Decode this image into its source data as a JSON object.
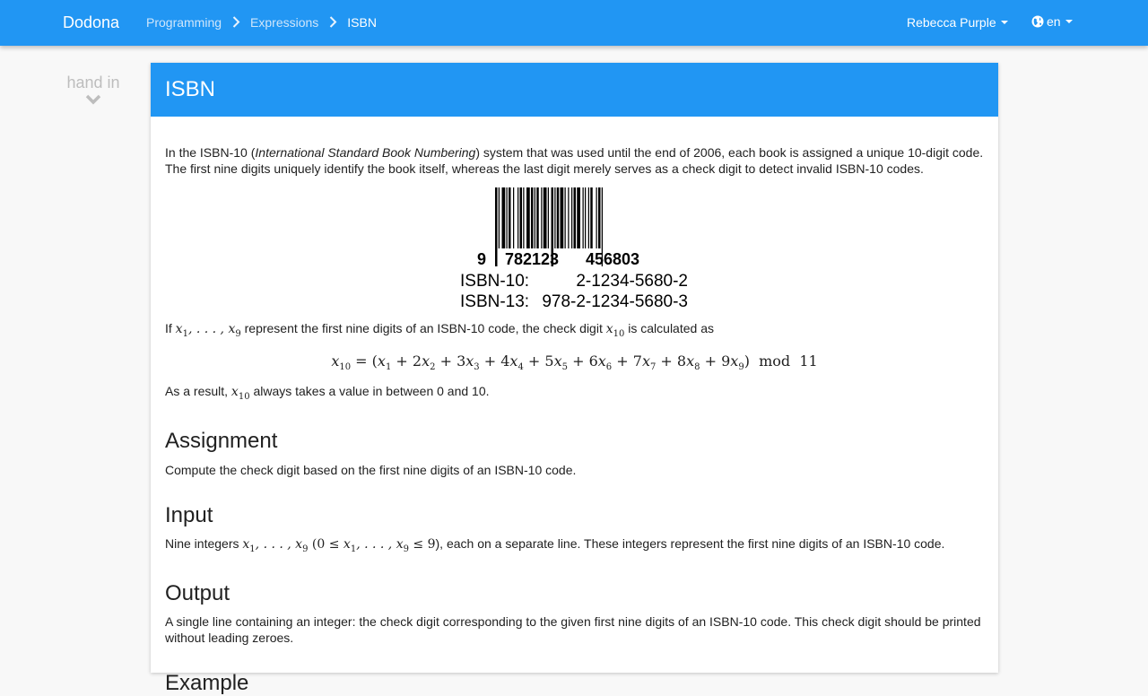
{
  "nav": {
    "brand": "Dodona",
    "breadcrumbs": [
      "Programming",
      "Expressions",
      "ISBN"
    ],
    "user": "Rebecca Purple",
    "language": "en"
  },
  "sidebar": {
    "handin_label": "hand in"
  },
  "exercise": {
    "title": "ISBN",
    "intro": {
      "p1_before": "In the ISBN-10 (",
      "p1_italic": "International Standard Book Numbering",
      "p1_after": ") system that was used until the end of 2006, each book is assigned a unique 10-digit code. The first nine digits uniquely identify the book itself, whereas the last digit merely serves as a check digit to detect invalid ISBN-10 codes."
    },
    "barcode": {
      "left_digit": "9",
      "group1": "782123",
      "group2": "456803",
      "isbn10_label": "ISBN-10:",
      "isbn10_value": "2-1234-5680-2",
      "isbn13_label": "ISBN-13:",
      "isbn13_value": "978-2-1234-5680-3"
    },
    "check_digit_sentence": {
      "if": "If",
      "represent": "represent the first nine digits of an ISBN-10 code, the check digit",
      "calculated": "is calculated as"
    },
    "formula": "x10 = (x1 + 2x2 + 3x3 + 4x4 + 5x5 + 6x6 + 7x7 + 8x8 + 9x9) mod 11",
    "result_sentence": {
      "before": "As a result,",
      "after": "always takes a value in between 0 and 10."
    },
    "assignment": {
      "heading": "Assignment",
      "text": "Compute the check digit based on the first nine digits of an ISBN-10 code."
    },
    "input": {
      "heading": "Input",
      "before": "Nine integers",
      "after": "), each on a separate line. These integers represent the first nine digits of an ISBN-10 code."
    },
    "output": {
      "heading": "Output",
      "text": "A single line containing an integer: the check digit corresponding to the given first nine digits of an ISBN-10 code. This check digit should be printed without leading zeroes."
    },
    "example": {
      "heading": "Example"
    }
  }
}
